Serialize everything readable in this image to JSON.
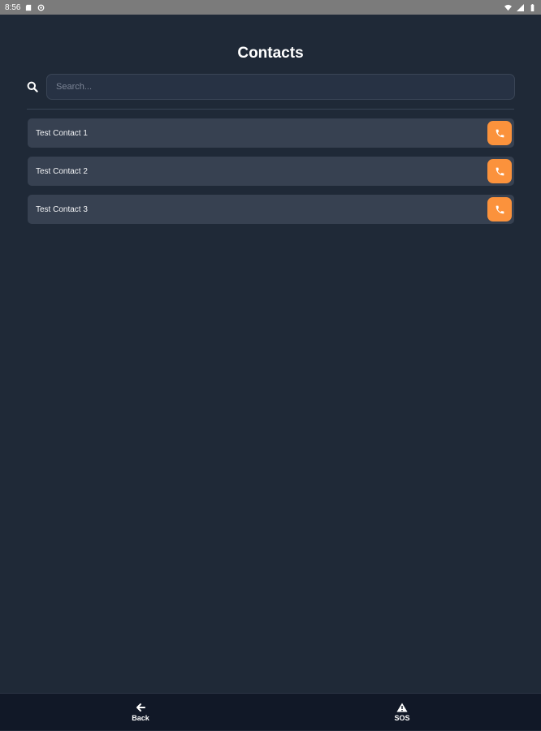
{
  "status_bar": {
    "time": "8:56",
    "left_icons": [
      "sd-card-icon",
      "sync-icon"
    ],
    "right_icons": [
      "wifi-icon",
      "signal-icon",
      "battery-icon"
    ]
  },
  "page": {
    "title": "Contacts"
  },
  "search": {
    "placeholder": "Search...",
    "value": ""
  },
  "contacts": [
    {
      "name": "Test Contact 1",
      "action_icon": "phone-icon"
    },
    {
      "name": "Test Contact 2",
      "action_icon": "phone-icon"
    },
    {
      "name": "Test Contact 3",
      "action_icon": "phone-icon"
    }
  ],
  "bottom_nav": {
    "back_label": "Back",
    "sos_label": "SOS"
  },
  "colors": {
    "background": "#1f2937",
    "card": "#374151",
    "accent": "#fb923c",
    "nav_background": "#111827"
  }
}
